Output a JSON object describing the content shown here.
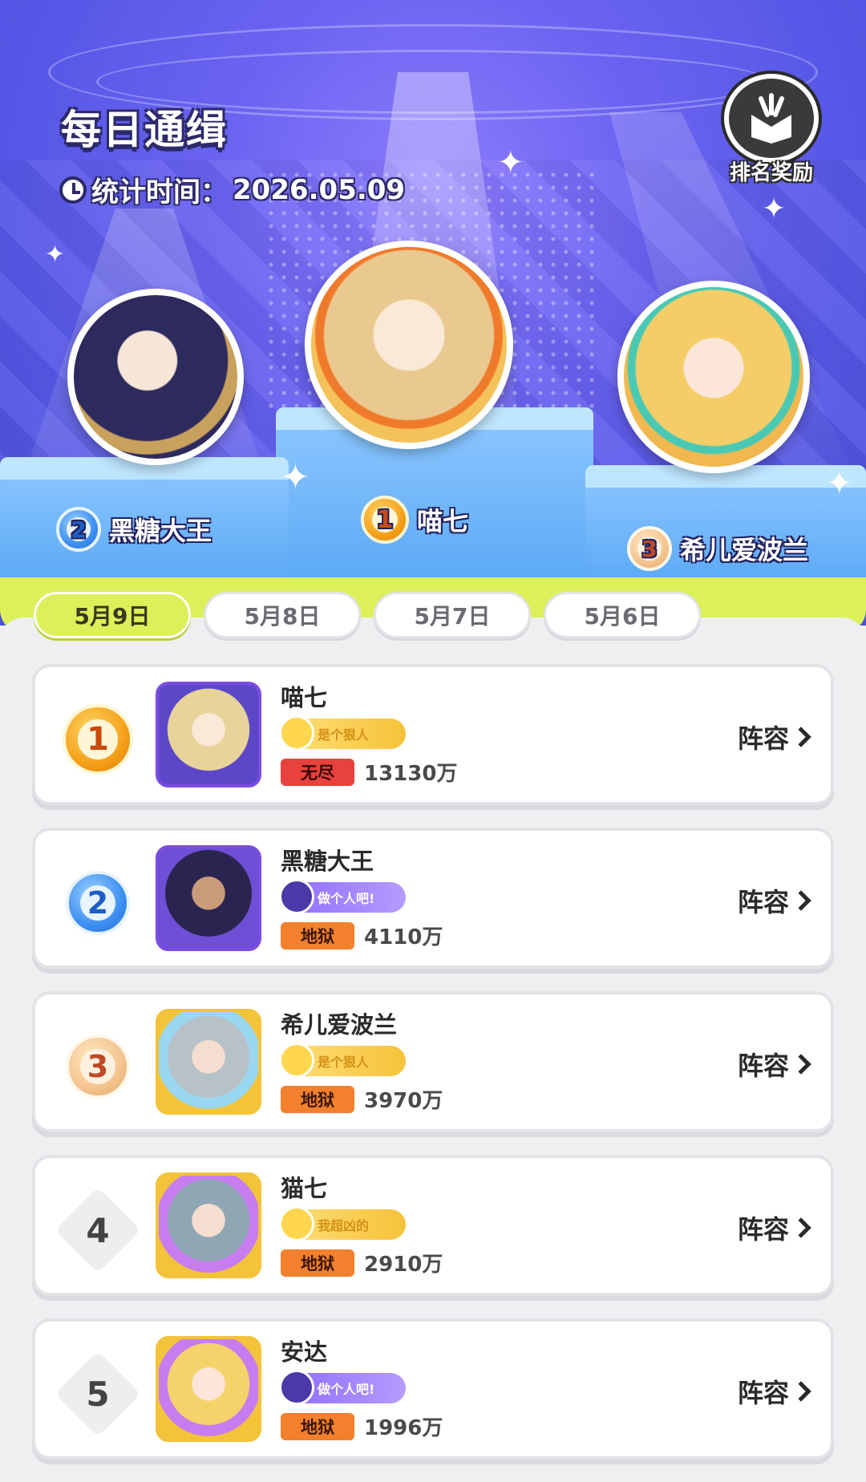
{
  "header": {
    "title": "每日通缉",
    "stat_label": "统计时间：",
    "stat_date": "2026.05.09",
    "reward_label": "排名奖励"
  },
  "podium": [
    {
      "rank": "2",
      "name": "黑糖大王"
    },
    {
      "rank": "1",
      "name": "喵七"
    },
    {
      "rank": "3",
      "name": "希儿爱波兰"
    }
  ],
  "tabs": [
    {
      "label": "5月9日",
      "active": true
    },
    {
      "label": "5月8日",
      "active": false
    },
    {
      "label": "5月7日",
      "active": false
    },
    {
      "label": "5月6日",
      "active": false
    }
  ],
  "rows": [
    {
      "rank": "1",
      "name": "喵七",
      "title": "是个狠人",
      "mode": "无尽",
      "value": "13130万",
      "action": "阵容"
    },
    {
      "rank": "2",
      "name": "黑糖大王",
      "title": "做个人吧!",
      "mode": "地狱",
      "value": "4110万",
      "action": "阵容"
    },
    {
      "rank": "3",
      "name": "希儿爱波兰",
      "title": "是个狠人",
      "mode": "地狱",
      "value": "3970万",
      "action": "阵容"
    },
    {
      "rank": "4",
      "name": "猫七",
      "title": "我超凶的",
      "mode": "地狱",
      "value": "2910万",
      "action": "阵容"
    },
    {
      "rank": "5",
      "name": "安达",
      "title": "做个人吧!",
      "mode": "地狱",
      "value": "1996万",
      "action": "阵容"
    }
  ],
  "colors": {
    "hero_bg": "#5a58e8",
    "accent_lime": "#dcf05a",
    "gold": "#f5a019",
    "silver_blue": "#3d8ff2",
    "bronze": "#e2a76a",
    "mode_red": "#e8423c",
    "mode_orange": "#f2802c"
  }
}
